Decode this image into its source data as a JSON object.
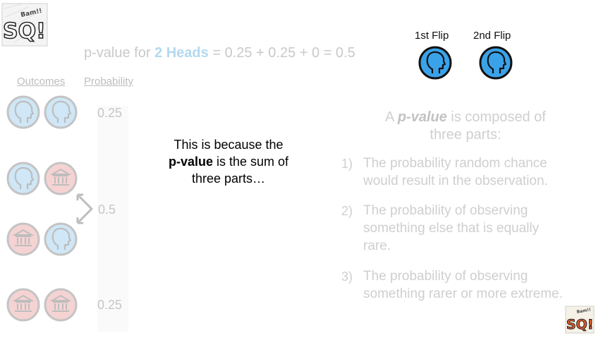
{
  "logo_text": "Bam!! SQ!",
  "formula": {
    "prefix": "p-value for ",
    "highlight": "2 Heads",
    "suffix": " = 0.25 + 0.25 + 0 = 0.5"
  },
  "flips": {
    "first_label": "1st Flip",
    "second_label": "2nd Flip"
  },
  "columns": {
    "outcomes": "Outcomes",
    "probability": "Probability"
  },
  "outcomes": [
    {
      "first": "heads",
      "second": "heads"
    },
    {
      "first": "heads",
      "second": "tails"
    },
    {
      "first": "tails",
      "second": "heads"
    },
    {
      "first": "tails",
      "second": "tails"
    }
  ],
  "probabilities": {
    "top": "0.25",
    "middle": "0.5",
    "bottom": "0.25"
  },
  "center_text": {
    "line1": "This is because the",
    "bold": "p-value",
    "line2_rest": " is the sum of",
    "line3": "three parts…"
  },
  "right_panel": {
    "title_prefix": "A ",
    "title_term": "p-value",
    "title_suffix": " is composed of",
    "title_line2": "three parts:",
    "items": [
      {
        "num": "1)",
        "line1": "The probability random chance",
        "line2": "would result in the observation."
      },
      {
        "num": "2)",
        "line1": "The probability of observing",
        "line2": "something else that is equally",
        "line3": "rare."
      },
      {
        "num": "3)",
        "line1": "The probability of observing",
        "line2": "something rarer or more extreme."
      }
    ]
  },
  "colors": {
    "head_fill_active": "#3aa2e8",
    "head_fill_faded": "#cfe7f6",
    "tails_fill_faded": "#f6d3d3",
    "arrow": "#bdbdbd"
  }
}
